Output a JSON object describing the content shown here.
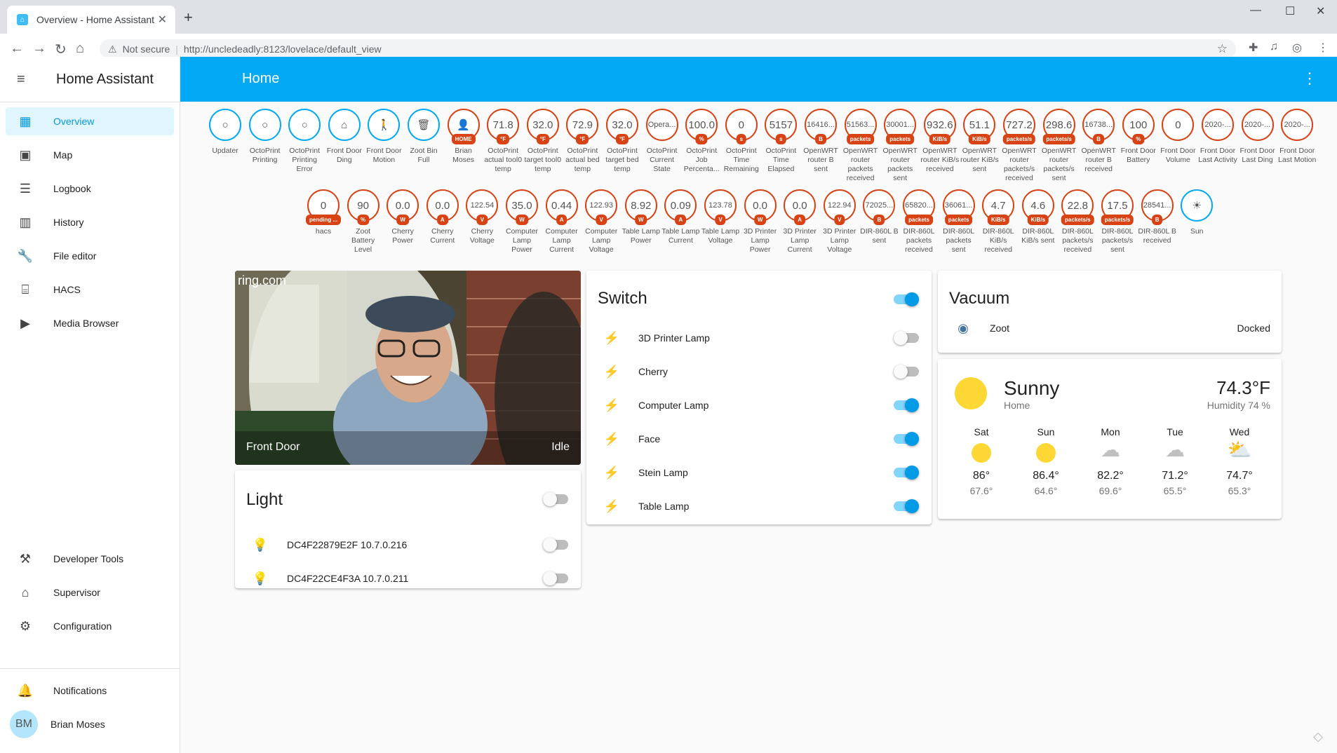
{
  "browser": {
    "tab_title": "Overview - Home Assistant",
    "security": "Not secure",
    "url": "http://uncledeadly:8123/lovelace/default_view"
  },
  "sidebar": {
    "title": "Home Assistant",
    "items": [
      {
        "label": "Overview",
        "icon": "overview-icon",
        "active": true
      },
      {
        "label": "Map",
        "icon": "map-icon"
      },
      {
        "label": "Logbook",
        "icon": "logbook-icon"
      },
      {
        "label": "History",
        "icon": "history-icon"
      },
      {
        "label": "File editor",
        "icon": "wrench-icon"
      },
      {
        "label": "HACS",
        "icon": "hacs-icon"
      },
      {
        "label": "Media Browser",
        "icon": "media-icon"
      }
    ],
    "bottom_items": [
      {
        "label": "Developer Tools",
        "icon": "hammer-icon"
      },
      {
        "label": "Supervisor",
        "icon": "supervisor-icon"
      },
      {
        "label": "Configuration",
        "icon": "gear-icon"
      }
    ],
    "notifications": "Notifications",
    "user_initials": "BM",
    "user_name": "Brian Moses"
  },
  "header": {
    "title": "Home"
  },
  "badges_row1": [
    {
      "value": "○",
      "unit": "",
      "label": "Updater",
      "kind": "state"
    },
    {
      "value": "○",
      "unit": "",
      "label": "OctoPrint Printing",
      "kind": "state"
    },
    {
      "value": "○",
      "unit": "",
      "label": "OctoPrint Printing Error",
      "kind": "state"
    },
    {
      "value": "⌂",
      "unit": "",
      "label": "Front Door Ding",
      "kind": "state"
    },
    {
      "value": "🚶",
      "unit": "",
      "label": "Front Door Motion",
      "kind": "state"
    },
    {
      "value": "🗑",
      "unit": "",
      "label": "Zoot Bin Full",
      "kind": "state"
    },
    {
      "value": "👤",
      "unit": "HOME",
      "label": "Brian Moses",
      "kind": "person"
    },
    {
      "value": "71.8",
      "unit": "°F",
      "label": "OctoPrint actual tool0 temp"
    },
    {
      "value": "32.0",
      "unit": "°F",
      "label": "OctoPrint target tool0 temp"
    },
    {
      "value": "72.9",
      "unit": "°F",
      "label": "OctoPrint actual bed temp"
    },
    {
      "value": "32.0",
      "unit": "°F",
      "label": "OctoPrint target bed temp"
    },
    {
      "value": "Opera...",
      "unit": "",
      "label": "OctoPrint Current State"
    },
    {
      "value": "100.0",
      "unit": "%",
      "label": "OctoPrint Job Percenta..."
    },
    {
      "value": "0",
      "unit": "s",
      "label": "OctoPrint Time Remaining"
    },
    {
      "value": "5157",
      "unit": "s",
      "label": "OctoPrint Time Elapsed"
    },
    {
      "value": "16416...",
      "unit": "B",
      "label": "OpenWRT router B sent"
    },
    {
      "value": "51563...",
      "unit": "packets",
      "label": "OpenWRT router packets received"
    },
    {
      "value": "30001...",
      "unit": "packets",
      "label": "OpenWRT router packets sent"
    },
    {
      "value": "932.6",
      "unit": "KiB/s",
      "label": "OpenWRT router KiB/s received"
    },
    {
      "value": "51.1",
      "unit": "KiB/s",
      "label": "OpenWRT router KiB/s sent"
    },
    {
      "value": "727.2",
      "unit": "packets/s",
      "label": "OpenWRT router packets/s received"
    },
    {
      "value": "298.6",
      "unit": "packets/s",
      "label": "OpenWRT router packets/s sent"
    },
    {
      "value": "16738...",
      "unit": "B",
      "label": "OpenWRT router B received"
    },
    {
      "value": "100",
      "unit": "%",
      "label": "Front Door Battery"
    },
    {
      "value": "0",
      "unit": "",
      "label": "Front Door Volume"
    },
    {
      "value": "2020-...",
      "unit": "",
      "label": "Front Door Last Activity"
    },
    {
      "value": "2020-...",
      "unit": "",
      "label": "Front Door Last Ding"
    },
    {
      "value": "2020-...",
      "unit": "",
      "label": "Front Door Last Motion"
    }
  ],
  "badges_row2": [
    {
      "value": "0",
      "unit": "pending ...",
      "label": "hacs"
    },
    {
      "value": "90",
      "unit": "%",
      "label": "Zoot Battery Level"
    },
    {
      "value": "0.0",
      "unit": "W",
      "label": "Cherry Power"
    },
    {
      "value": "0.0",
      "unit": "A",
      "label": "Cherry Current"
    },
    {
      "value": "122.54",
      "unit": "V",
      "label": "Cherry Voltage"
    },
    {
      "value": "35.0",
      "unit": "W",
      "label": "Computer Lamp Power"
    },
    {
      "value": "0.44",
      "unit": "A",
      "label": "Computer Lamp Current"
    },
    {
      "value": "122.93",
      "unit": "V",
      "label": "Computer Lamp Voltage"
    },
    {
      "value": "8.92",
      "unit": "W",
      "label": "Table Lamp Power"
    },
    {
      "value": "0.09",
      "unit": "A",
      "label": "Table Lamp Current"
    },
    {
      "value": "123.78",
      "unit": "V",
      "label": "Table Lamp Voltage"
    },
    {
      "value": "0.0",
      "unit": "W",
      "label": "3D Printer Lamp Power"
    },
    {
      "value": "0.0",
      "unit": "A",
      "label": "3D Printer Lamp Current"
    },
    {
      "value": "122.94",
      "unit": "V",
      "label": "3D Printer Lamp Voltage"
    },
    {
      "value": "72025...",
      "unit": "B",
      "label": "DIR-860L B sent"
    },
    {
      "value": "65820...",
      "unit": "packets",
      "label": "DIR-860L packets received"
    },
    {
      "value": "36061...",
      "unit": "packets",
      "label": "DIR-860L packets sent"
    },
    {
      "value": "4.7",
      "unit": "KiB/s",
      "label": "DIR-860L KiB/s received"
    },
    {
      "value": "4.6",
      "unit": "KiB/s",
      "label": "DIR-860L KiB/s sent"
    },
    {
      "value": "22.8",
      "unit": "packets/s",
      "label": "DIR-860L packets/s received"
    },
    {
      "value": "17.5",
      "unit": "packets/s",
      "label": "DIR-860L packets/s sent"
    },
    {
      "value": "28541...",
      "unit": "B",
      "label": "DIR-860L B received"
    },
    {
      "value": "☀",
      "unit": "",
      "label": "Sun",
      "kind": "state"
    }
  ],
  "camera": {
    "name": "Front Door",
    "state": "Idle",
    "brand": "ring.com"
  },
  "light": {
    "title": "Light",
    "rows": [
      {
        "label": "DC4F22879E2F 10.7.0.216",
        "on": false
      },
      {
        "label": "DC4F22CE4F3A 10.7.0.211",
        "on": false
      }
    ]
  },
  "switch": {
    "title": "Switch",
    "rows": [
      {
        "label": "3D Printer Lamp",
        "on": false
      },
      {
        "label": "Cherry",
        "on": false
      },
      {
        "label": "Computer Lamp",
        "on": true
      },
      {
        "label": "Face",
        "on": true
      },
      {
        "label": "Stein Lamp",
        "on": true
      },
      {
        "label": "Table Lamp",
        "on": true
      }
    ]
  },
  "vacuum": {
    "title": "Vacuum",
    "name": "Zoot",
    "state": "Docked"
  },
  "weather": {
    "condition": "Sunny",
    "location": "Home",
    "temp": "74.3°F",
    "humidity": "Humidity 74 %",
    "forecast": [
      {
        "day": "Sat",
        "icon": "sun",
        "high": "86°",
        "low": "67.6°"
      },
      {
        "day": "Sun",
        "icon": "sun",
        "high": "86.4°",
        "low": "64.6°"
      },
      {
        "day": "Mon",
        "icon": "cloud",
        "high": "82.2°",
        "low": "69.6°"
      },
      {
        "day": "Tue",
        "icon": "cloud",
        "high": "71.2°",
        "low": "65.5°"
      },
      {
        "day": "Wed",
        "icon": "partly-cloudy",
        "high": "74.7°",
        "low": "65.3°"
      }
    ]
  },
  "colors": {
    "primary": "#03a9f4",
    "badge_border": "#d84315",
    "state_icon": "#44739e",
    "sun": "#fdd835"
  }
}
